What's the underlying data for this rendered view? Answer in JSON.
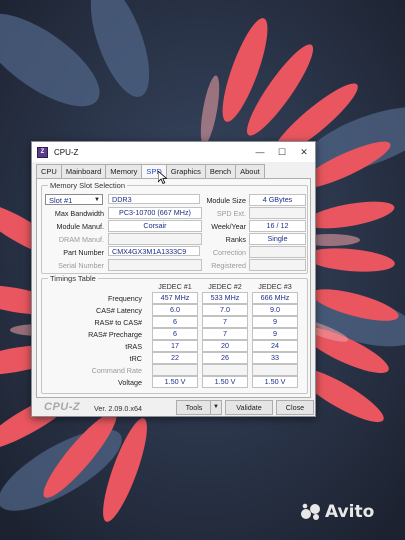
{
  "window": {
    "title": "CPU-Z",
    "controls": {
      "minimize": "—",
      "maximize": "☐",
      "close": "✕"
    }
  },
  "tabs": [
    "CPU",
    "Mainboard",
    "Memory",
    "SPD",
    "Graphics",
    "Bench",
    "About"
  ],
  "active_tab": "SPD",
  "slot_selection": {
    "group_label": "Memory Slot Selection",
    "slot_value": "Slot #1",
    "memory_type": "DDR3",
    "module_size_label": "Module Size",
    "module_size": "4 GBytes",
    "max_bandwidth_label": "Max Bandwidth",
    "max_bandwidth": "PC3-10700 (667 MHz)",
    "spd_ext_label": "SPD Ext.",
    "spd_ext": "",
    "manuf_label": "Module Manuf.",
    "manuf": "Corsair",
    "week_year_label": "Week/Year",
    "week_year": "16 / 12",
    "dram_manuf_label": "DRAM Manuf.",
    "dram_manuf": "",
    "ranks_label": "Ranks",
    "ranks": "Single",
    "part_number_label": "Part Number",
    "part_number": "CMX4GX3M1A1333C9",
    "correction_label": "Correction",
    "correction": "",
    "serial_label": "Serial Number",
    "serial": "",
    "registered_label": "Registered",
    "registered": ""
  },
  "timings": {
    "group_label": "Timings Table",
    "columns": [
      "JEDEC #1",
      "JEDEC #2",
      "JEDEC #3"
    ],
    "rows": [
      {
        "label": "Frequency",
        "values": [
          "457 MHz",
          "533 MHz",
          "666 MHz"
        ]
      },
      {
        "label": "CAS# Latency",
        "values": [
          "6.0",
          "7.0",
          "9.0"
        ]
      },
      {
        "label": "RAS# to CAS#",
        "values": [
          "6",
          "7",
          "9"
        ]
      },
      {
        "label": "RAS# Precharge",
        "values": [
          "6",
          "7",
          "9"
        ]
      },
      {
        "label": "tRAS",
        "values": [
          "17",
          "20",
          "24"
        ]
      },
      {
        "label": "tRC",
        "values": [
          "22",
          "26",
          "33"
        ]
      },
      {
        "label": "Command Rate",
        "values": [
          "",
          "",
          ""
        ]
      },
      {
        "label": "Voltage",
        "values": [
          "1.50 V",
          "1.50 V",
          "1.50 V"
        ]
      }
    ]
  },
  "footer": {
    "logo": "CPU-Z",
    "version": "Ver. 2.09.0.x64",
    "tools_label": "Tools",
    "validate_label": "Validate",
    "close_label": "Close"
  },
  "watermark": "Avito"
}
